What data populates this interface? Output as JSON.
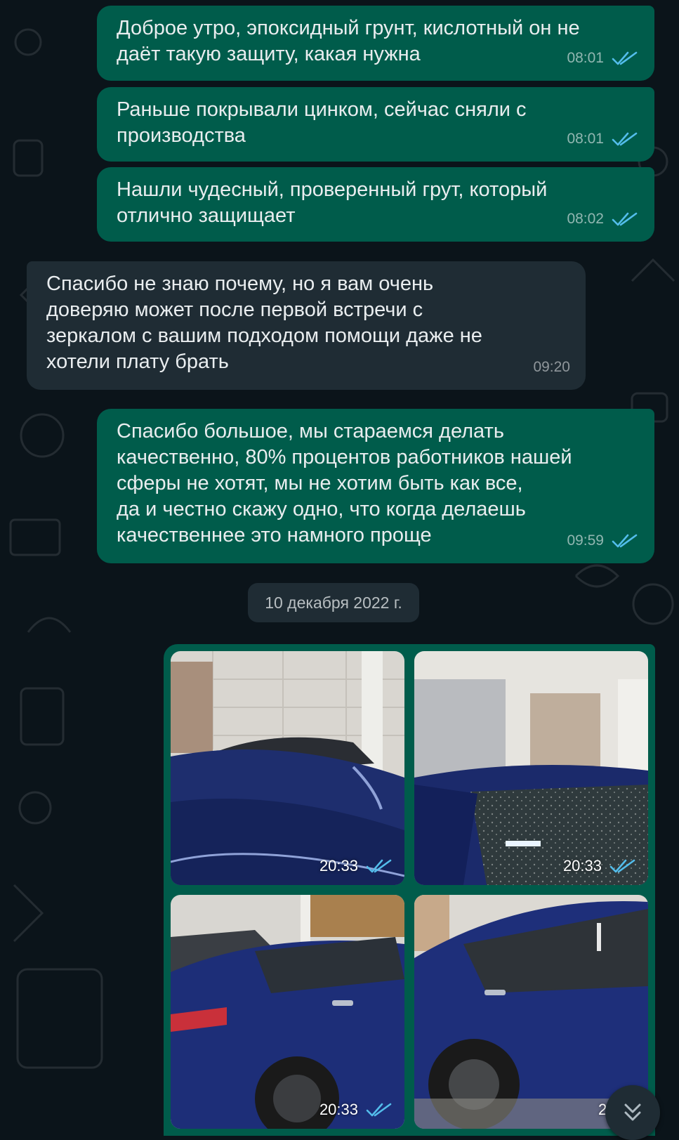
{
  "colors": {
    "background": "#0b141a",
    "outgoing_bubble": "#005c4b",
    "incoming_bubble": "#1f2c34",
    "read_ticks": "#53bdeb"
  },
  "messages": [
    {
      "direction": "out",
      "text": "Доброе утро, эпоксидный грунт, кислотный он не\nдаёт такую защиту, какая нужна",
      "time": "08:01",
      "status": "read"
    },
    {
      "direction": "out",
      "text": "Раньше покрывали цинком, сейчас сняли с\nпроизводства",
      "time": "08:01",
      "status": "read"
    },
    {
      "direction": "out",
      "text": "Нашли чудесный, проверенный грут, который\nотлично защищает",
      "time": "08:02",
      "status": "read"
    },
    {
      "direction": "in",
      "text": "Спасибо не знаю почему, но я вам очень\nдоверяю может после первой встречи с\nзеркалом с вашим подходом помощи даже не\nхотели плату брать",
      "time": "09:20"
    },
    {
      "direction": "out",
      "text": "Спасибо большое, мы стараемся делать\nкачественно, 80% процентов работников нашей\nсферы не хотят, мы не хотим быть как все,\nда и честно скажу одно, что когда делаешь\nкачественнее это намного проще",
      "time": "09:59",
      "status": "read"
    }
  ],
  "date_separator": "10 декабря 2022 г.",
  "album": {
    "photos": [
      {
        "time": "20:33",
        "status": "read",
        "description": "car-roof"
      },
      {
        "time": "20:33",
        "status": "read",
        "description": "car-windshield"
      },
      {
        "time": "20:33",
        "status": "read",
        "description": "car-rear-side"
      },
      {
        "time": "20:33",
        "status": "read",
        "description": "car-front-side"
      }
    ]
  },
  "icons": {
    "read_ticks": "double-check-icon",
    "scroll_down": "chevron-double-down-icon"
  }
}
